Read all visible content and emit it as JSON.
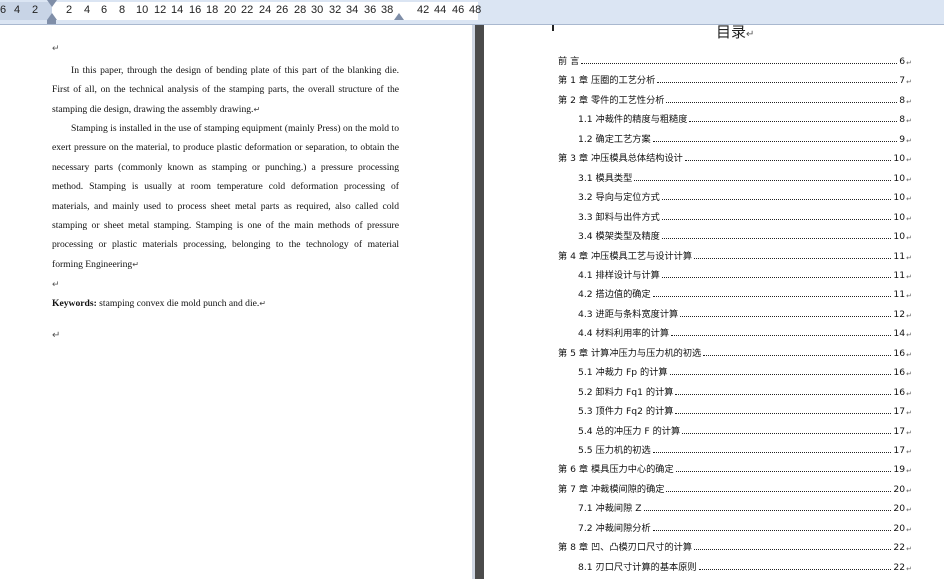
{
  "ruler": {
    "numbers": [
      "6",
      "4",
      "2",
      "2",
      "4",
      "6",
      "8",
      "10",
      "12",
      "14",
      "16",
      "18",
      "20",
      "22",
      "24",
      "26",
      "28",
      "30",
      "32",
      "34",
      "36",
      "38",
      "42",
      "44",
      "46",
      "48"
    ]
  },
  "left_page": {
    "top_mark": "↵",
    "paragraphs": [
      "In this paper, through the design of bending plate of this part of the blanking die. First of all, on the technical analysis of the stamping parts, the overall structure of the stamping die design, drawing the assembly drawing.",
      "Stamping is installed in the use of stamping equipment (mainly Press) on the mold to exert pressure on the material, to produce plastic deformation or separation, to obtain the necessary parts (commonly known as stamping or punching.) a pressure processing method. Stamping is usually at room temperature cold deformation processing of materials, and mainly used to process sheet metal parts as required, also called cold stamping or sheet metal stamping. Stamping is one of the main methods of pressure processing or plastic materials processing, belonging to the technology of material forming Engineering"
    ],
    "para_end_mark": "↵",
    "blank_mark": "↵",
    "keywords_label": "Keywords:",
    "keywords_text": " stamping convex die mold punch and die.",
    "end_mark": "↵"
  },
  "toc": {
    "title": "目录",
    "title_mark": "↵",
    "entries": [
      {
        "label": "前 言",
        "page": "6",
        "level": 1
      },
      {
        "label": "第 1 章  压圈的工艺分析",
        "page": "7",
        "level": 1
      },
      {
        "label": "第 2 章  零件的工艺性分析",
        "page": "8",
        "level": 1
      },
      {
        "label": "1.1  冲裁件的精度与粗糙度",
        "page": "8",
        "level": 2
      },
      {
        "label": "1.2  确定工艺方案",
        "page": "9",
        "level": 2
      },
      {
        "label": "第 3 章  冲压模具总体结构设计",
        "page": "10",
        "level": 1
      },
      {
        "label": "3.1  模具类型",
        "page": "10",
        "level": 2
      },
      {
        "label": "3.2  导向与定位方式",
        "page": "10",
        "level": 2
      },
      {
        "label": "3.3  卸料与出件方式",
        "page": "10",
        "level": 2
      },
      {
        "label": "3.4  模架类型及精度",
        "page": "10",
        "level": 2
      },
      {
        "label": "第 4 章  冲压模具工艺与设计计算",
        "page": "11",
        "level": 1
      },
      {
        "label": "4.1  排样设计与计算",
        "page": "11",
        "level": 2
      },
      {
        "label": "4.2  搭边值的确定",
        "page": "11",
        "level": 2
      },
      {
        "label": "4.3  进距与条料宽度计算",
        "page": "12",
        "level": 2
      },
      {
        "label": "4.4  材料利用率的计算",
        "page": "14",
        "level": 2
      },
      {
        "label": "第 5 章  计算冲压力与压力机的初选",
        "page": "16",
        "level": 1
      },
      {
        "label": "5.1  冲裁力 Fp 的计算",
        "page": "16",
        "level": 2
      },
      {
        "label": "5.2  卸料力 Fq1 的计算",
        "page": "16",
        "level": 2
      },
      {
        "label": "5.3  顶件力 Fq2 的计算",
        "page": "17",
        "level": 2
      },
      {
        "label": "5.4  总的冲压力 F 的计算",
        "page": "17",
        "level": 2
      },
      {
        "label": "5.5  压力机的初选",
        "page": "17",
        "level": 2
      },
      {
        "label": "第 6 章  模具压力中心的确定",
        "page": "19",
        "level": 1
      },
      {
        "label": "第 7 章  冲裁模间隙的确定",
        "page": "20",
        "level": 1
      },
      {
        "label": "7.1  冲裁间隙 Z",
        "page": "20",
        "level": 2
      },
      {
        "label": "7.2  冲裁间隙分析",
        "page": "20",
        "level": 2
      },
      {
        "label": "第 8 章  凹、凸模刃口尺寸的计算",
        "page": "22",
        "level": 1
      },
      {
        "label": "8.1  刃口尺寸计算的基本原则",
        "page": "22",
        "level": 2
      }
    ]
  }
}
